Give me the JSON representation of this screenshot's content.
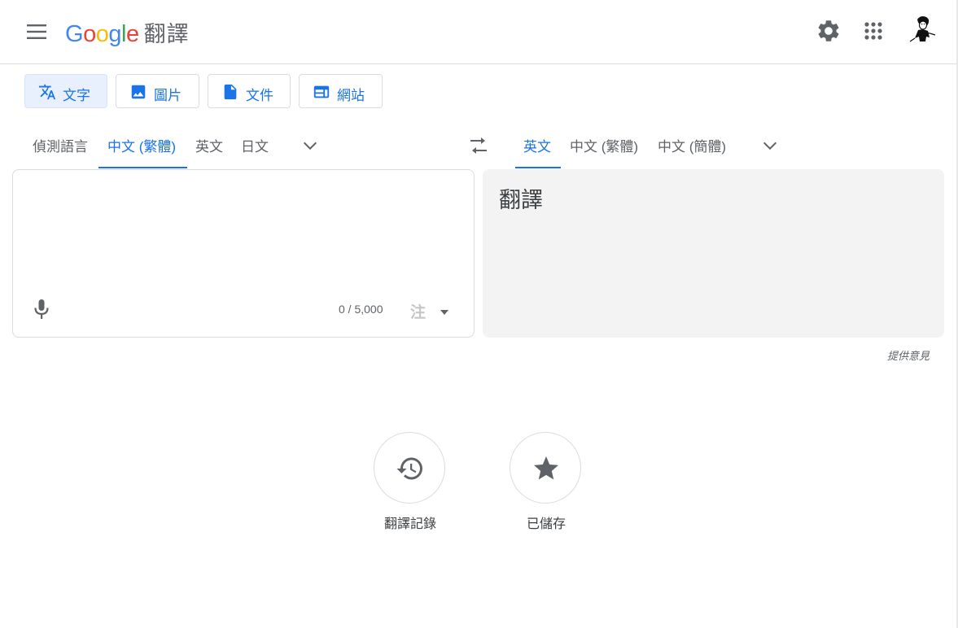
{
  "header": {
    "logo_letters": [
      "G",
      "o",
      "o",
      "g",
      "l",
      "e"
    ],
    "logo_colors": [
      "#4285f4",
      "#ea4335",
      "#fbbc05",
      "#4285f4",
      "#34a853",
      "#ea4335"
    ],
    "product_name": "翻譯"
  },
  "mode_tabs": [
    {
      "label": "文字",
      "icon": "translate-icon",
      "active": true
    },
    {
      "label": "圖片",
      "icon": "image-icon",
      "active": false
    },
    {
      "label": "文件",
      "icon": "document-icon",
      "active": false
    },
    {
      "label": "網站",
      "icon": "website-icon",
      "active": false
    }
  ],
  "source_languages": [
    {
      "label": "偵測語言",
      "active": false
    },
    {
      "label": "中文 (繁體)",
      "active": true
    },
    {
      "label": "英文",
      "active": false
    },
    {
      "label": "日文",
      "active": false
    }
  ],
  "target_languages": [
    {
      "label": "英文",
      "active": true
    },
    {
      "label": "中文 (繁體)",
      "active": false
    },
    {
      "label": "中文 (簡體)",
      "active": false
    }
  ],
  "source": {
    "value": "",
    "counter": "0 / 5,000",
    "ruby_label": "注"
  },
  "target": {
    "text": "翻譯"
  },
  "feedback_label": "提供意見",
  "bottom_buttons": [
    {
      "label": "翻譯記錄",
      "icon": "history-icon"
    },
    {
      "label": "已儲存",
      "icon": "star-icon"
    }
  ],
  "colors": {
    "accent": "#1a73e8",
    "icon_gray": "#5f6368",
    "active_tab_bg": "#e8f0fe",
    "target_bg": "#f3f3f3"
  }
}
